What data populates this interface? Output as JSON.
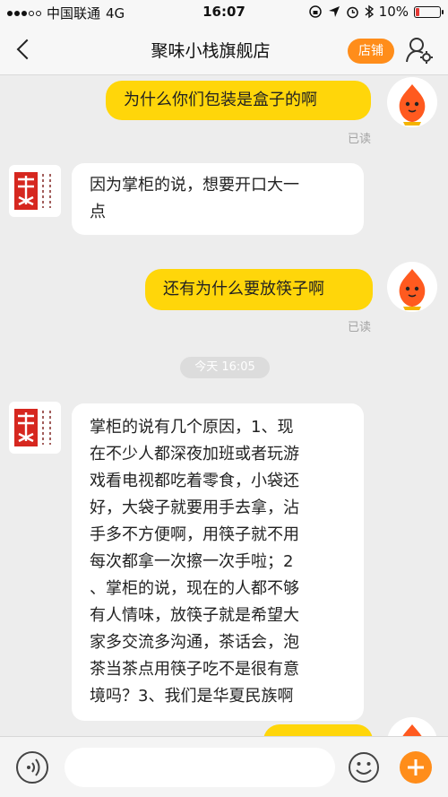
{
  "status_bar": {
    "carrier": "中国联通",
    "network": "4G",
    "time": "16:07",
    "battery": "10%"
  },
  "nav": {
    "title": "聚味小栈旗舰店",
    "shop_label": "店铺"
  },
  "messages": [
    {
      "side": "me",
      "text": "为什么你们包装是盒子的啊",
      "status": "已读"
    },
    {
      "side": "them",
      "lines": [
        "因为掌柜的说，想要开口大一",
        "点"
      ]
    },
    {
      "side": "me",
      "text": "还有为什么要放筷子啊",
      "status": "已读"
    },
    {
      "side": "system",
      "text": "今天 16:05"
    },
    {
      "side": "them",
      "lines": [
        "掌柜的说有几个原因，1、现",
        "在不少人都深夜加班或者玩游",
        "戏看电视都吃着零食，小袋还",
        "好，大袋子就要用手去拿，沾",
        "手多不方便啊，用筷子就不用",
        "每次都拿一次擦一次手啦；2",
        "、掌柜的说，现在的人都不够",
        "有人情味，放筷子就是希望大",
        "家多交流多沟通，茶话会，泡",
        "茶当茶点用筷子吃不是很有意",
        "境吗？3、我们是华夏民族啊"
      ]
    }
  ],
  "shop_logo_text": "聚味小栈",
  "input": {
    "placeholder": ""
  },
  "colors": {
    "accent_orange": "#ff8d1a",
    "my_bubble": "#ffd60a",
    "their_bubble": "#ffffff",
    "background": "#ededed"
  }
}
